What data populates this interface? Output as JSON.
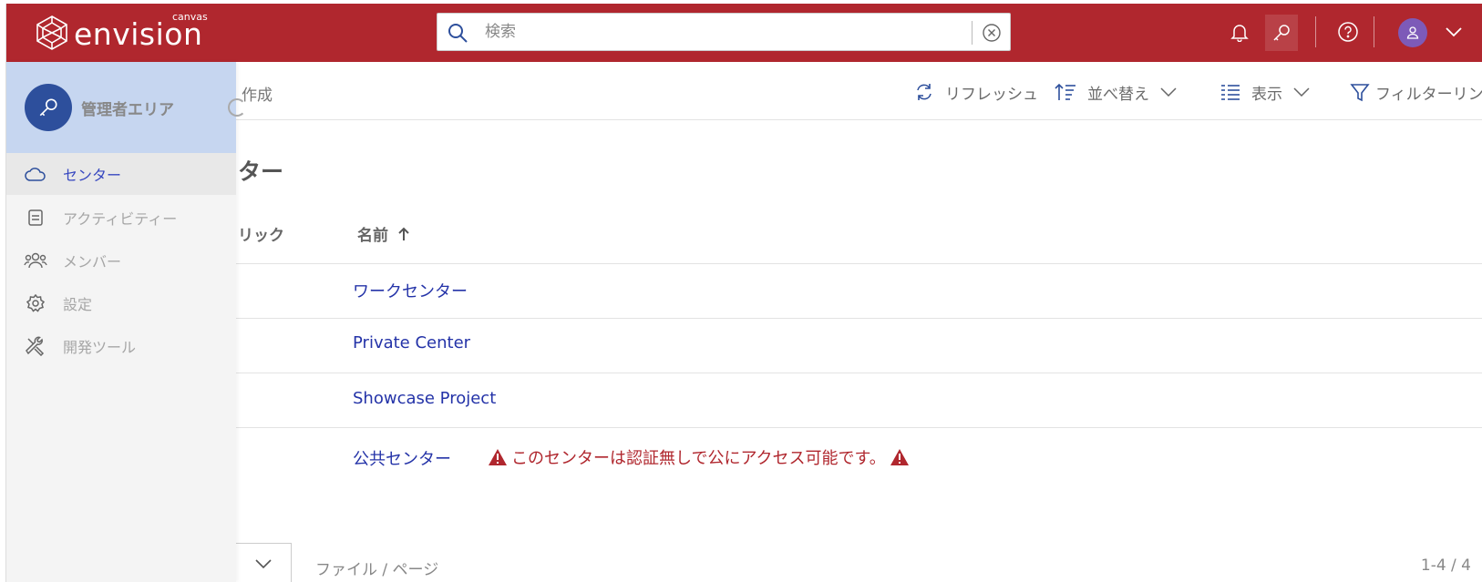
{
  "header": {
    "logo_text": "envision",
    "logo_sup": "canvas",
    "search_placeholder": "検索",
    "colors": {
      "brand": "#b0272e",
      "avatar": "#7d5ab8"
    },
    "icons": [
      "bell-icon",
      "key-icon",
      "help-icon",
      "user-icon",
      "chevron-down-icon"
    ]
  },
  "toolbar": {
    "create_partial": "作成",
    "refresh": "リフレッシュ",
    "sort": "並べ替え",
    "view": "表示",
    "filter": "フィルターリング"
  },
  "main": {
    "title_partial": "ター",
    "columns": {
      "public_partial": "リック",
      "name": "名前"
    },
    "rows": [
      {
        "name": "ワークセンター"
      },
      {
        "name": "Private Center"
      },
      {
        "name": "Showcase Project"
      },
      {
        "name": "公共センター"
      }
    ],
    "public_warning": "このセンターは認証無しで公にアクセス可能です。",
    "link_color": "#2433a8",
    "warning_color": "#b0272e"
  },
  "pagination": {
    "per_page_label": "ファイル / ページ",
    "range": "1-4 / 4"
  },
  "sidebar": {
    "admin_label": "管理者エリア",
    "active_color": "#3748c0",
    "items": [
      {
        "label": "センター",
        "icon": "cloud-icon",
        "active": true
      },
      {
        "label": "アクティビティー",
        "icon": "activity-icon",
        "active": false
      },
      {
        "label": "メンバー",
        "icon": "members-icon",
        "active": false
      },
      {
        "label": "設定",
        "icon": "gear-icon",
        "active": false
      },
      {
        "label": "開発ツール",
        "icon": "tools-icon",
        "active": false
      }
    ]
  }
}
